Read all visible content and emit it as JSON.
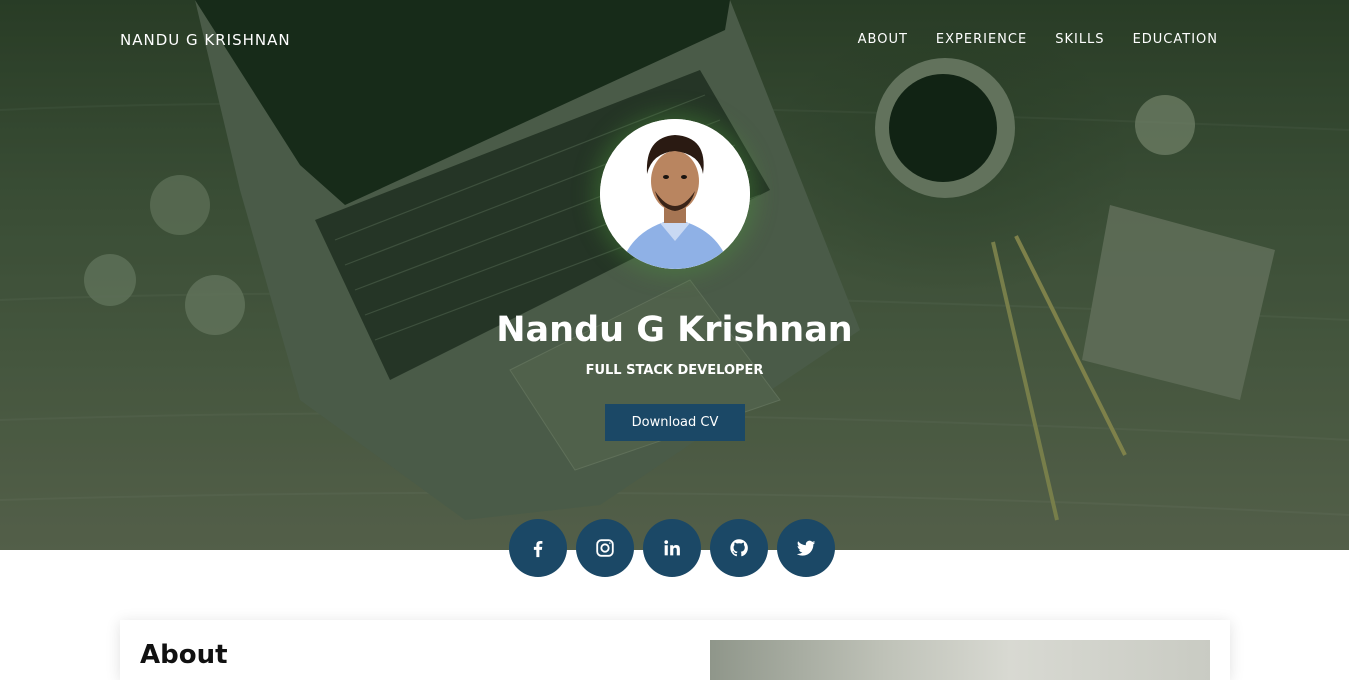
{
  "header": {
    "brand": "NANDU G KRISHNAN",
    "nav": [
      {
        "label": "ABOUT"
      },
      {
        "label": "EXPERIENCE"
      },
      {
        "label": "SKILLS"
      },
      {
        "label": "EDUCATION"
      }
    ]
  },
  "hero": {
    "name": "Nandu G Krishnan",
    "role": "FULL STACK DEVELOPER",
    "cv_button": "Download CV"
  },
  "social": [
    {
      "icon": "facebook-icon"
    },
    {
      "icon": "instagram-icon"
    },
    {
      "icon": "linkedin-icon"
    },
    {
      "icon": "github-icon"
    },
    {
      "icon": "twitter-icon"
    }
  ],
  "about": {
    "title": "About"
  },
  "colors": {
    "accent": "#1b4866",
    "hero_overlay": "#2f4a2b"
  }
}
